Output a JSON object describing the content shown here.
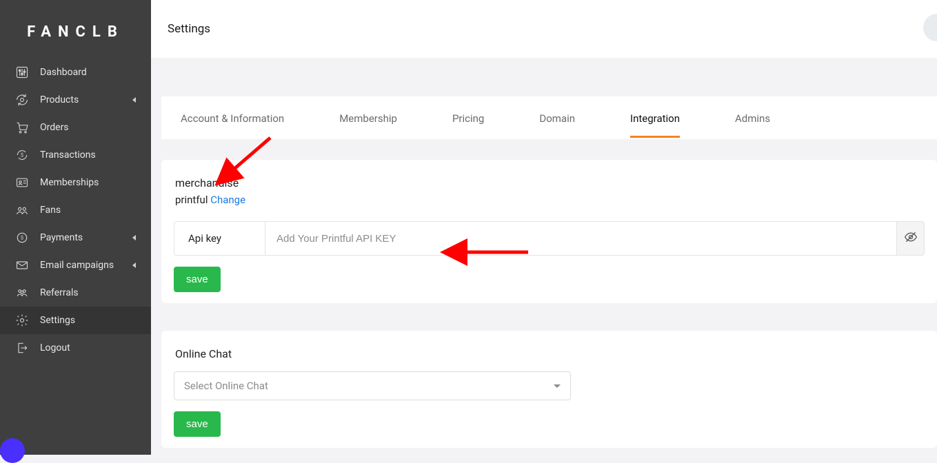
{
  "brand": "FANCLB",
  "header": {
    "title": "Settings"
  },
  "sidebar": {
    "items": [
      {
        "label": "Dashboard",
        "icon": "sliders"
      },
      {
        "label": "Products",
        "icon": "refresh",
        "chevron": true
      },
      {
        "label": "Orders",
        "icon": "cart"
      },
      {
        "label": "Transactions",
        "icon": "dollar-sync"
      },
      {
        "label": "Memberships",
        "icon": "id-card"
      },
      {
        "label": "Fans",
        "icon": "people"
      },
      {
        "label": "Payments",
        "icon": "coin",
        "chevron": true
      },
      {
        "label": "Email campaigns",
        "icon": "mail",
        "chevron": true
      },
      {
        "label": "Referrals",
        "icon": "group"
      },
      {
        "label": "Settings",
        "icon": "gear",
        "active": true
      },
      {
        "label": "Logout",
        "icon": "exit"
      }
    ]
  },
  "tabs": [
    {
      "label": "Account & Information"
    },
    {
      "label": "Membership"
    },
    {
      "label": "Pricing"
    },
    {
      "label": "Domain"
    },
    {
      "label": "Integration",
      "active": true
    },
    {
      "label": "Admins"
    }
  ],
  "merchandise": {
    "heading": "merchandise",
    "provider": "printful",
    "change_label": "Change",
    "api_key_label": "Api key",
    "api_key_placeholder": "Add Your Printful API KEY",
    "save_label": "save"
  },
  "online_chat": {
    "heading": "Online Chat",
    "select_placeholder": "Select Online Chat",
    "save_label": "save"
  }
}
